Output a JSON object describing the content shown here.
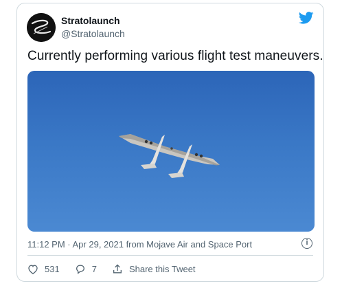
{
  "tweet": {
    "author_name": "Stratolaunch",
    "author_handle": "@Stratolaunch",
    "text": "Currently performing various flight test maneuvers.",
    "timestamp": "11:12 PM · Apr 29, 2021 from Mojave Air and Space Port",
    "info_symbol": "i"
  },
  "actions": {
    "like_count": "531",
    "reply_count": "7",
    "share_label": "Share this Tweet"
  },
  "icons": {
    "brand": "twitter-bird-icon",
    "avatar": "stratolaunch-logo",
    "like": "heart-icon",
    "reply": "reply-bubble-icon",
    "share": "share-icon",
    "info": "info-icon"
  },
  "colors": {
    "brand_blue": "#1d9bf0",
    "text_primary": "#0f1419",
    "text_secondary": "#536471",
    "border": "#cfd9de",
    "sky": "#3a78c6"
  }
}
